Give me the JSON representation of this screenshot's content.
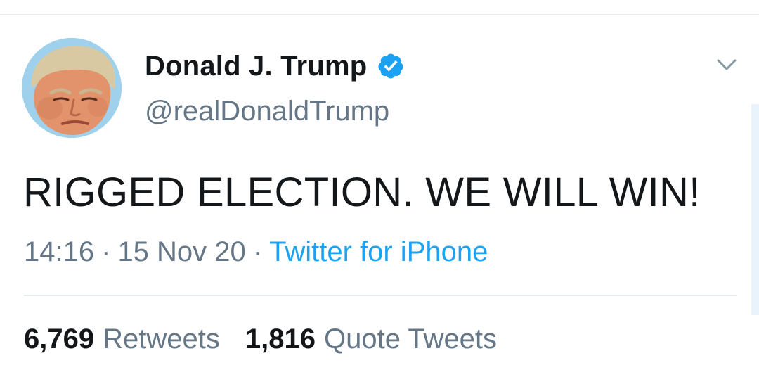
{
  "tweet": {
    "author": {
      "display_name": "Donald J. Trump",
      "handle": "@realDonaldTrump",
      "verified": true,
      "avatar_icon": "profile-photo"
    },
    "text": "RIGGED ELECTION. WE WILL WIN!",
    "time": "14:16",
    "date": "15 Nov 20",
    "separator": "·",
    "source": "Twitter for iPhone",
    "stats": {
      "retweets_count": "6,769",
      "retweets_label": "Retweets",
      "quote_tweets_count": "1,816",
      "quote_tweets_label": "Quote Tweets"
    },
    "menu_icon": "chevron-down-icon"
  },
  "colors": {
    "primary_text": "#14171a",
    "secondary_text": "#657786",
    "link": "#1da1f2",
    "verified_badge": "#1da1f2",
    "divider": "#e6ecf0"
  }
}
